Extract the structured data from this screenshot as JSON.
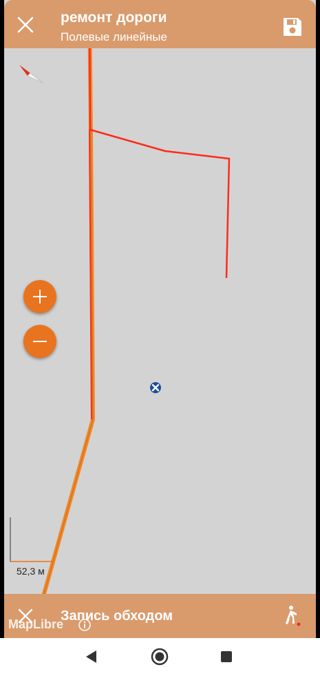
{
  "header": {
    "title": "ремонт дороги",
    "subtitle": "Полевые линейные"
  },
  "map": {
    "scale_label": "52,3 м",
    "attribution": "MapLibre",
    "colors": {
      "background": "#d3d3d3",
      "road": "#f0892a",
      "track": "#ff2a1a",
      "accent": "#e8741f"
    }
  },
  "recording": {
    "label": "Запись обходом"
  },
  "icons": {
    "close": "close-icon",
    "save": "save-icon",
    "compass": "compass-icon",
    "zoom_in": "plus-icon",
    "zoom_out": "minus-icon",
    "walk": "walking-person-icon",
    "back": "back-triangle-icon",
    "home": "home-circle-icon",
    "recents": "recents-square-icon"
  }
}
